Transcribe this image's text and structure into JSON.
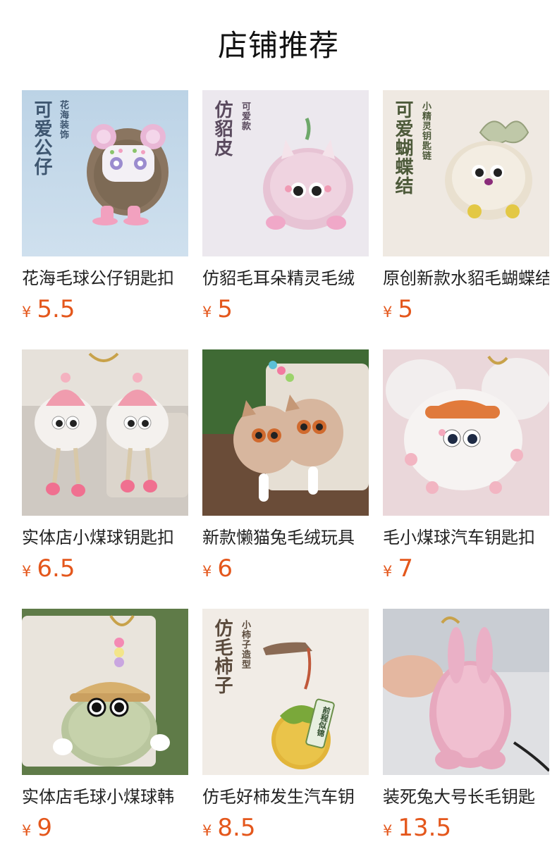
{
  "header": {
    "title": "店铺推荐"
  },
  "currency_symbol": "¥",
  "products": [
    {
      "name": "花海毛球公仔钥匙扣",
      "price": "5.5",
      "img_main": "可爱公仔",
      "img_sub": "花海装饰"
    },
    {
      "name": "仿貂毛耳朵精灵毛绒",
      "price": "5",
      "img_main": "仿貂皮",
      "img_sub": "可爱款"
    },
    {
      "name": "原创新款水貂毛蝴蝶结",
      "price": "5",
      "img_main": "可爱蝴蝶结",
      "img_sub": "小精灵钥匙链"
    },
    {
      "name": "实体店小煤球钥匙扣",
      "price": "6.5"
    },
    {
      "name": "新款懒猫兔毛绒玩具",
      "price": "6"
    },
    {
      "name": "毛小煤球汽车钥匙扣",
      "price": "7"
    },
    {
      "name": "实体店毛球小煤球韩",
      "price": "9"
    },
    {
      "name": "仿毛好柿发生汽车钥",
      "price": "8.5",
      "img_main": "仿毛柿子",
      "img_sub": "小柿子造型",
      "tag_text": "前程似锦"
    },
    {
      "name": "装死兔大号长毛钥匙",
      "price": "13.5"
    }
  ]
}
